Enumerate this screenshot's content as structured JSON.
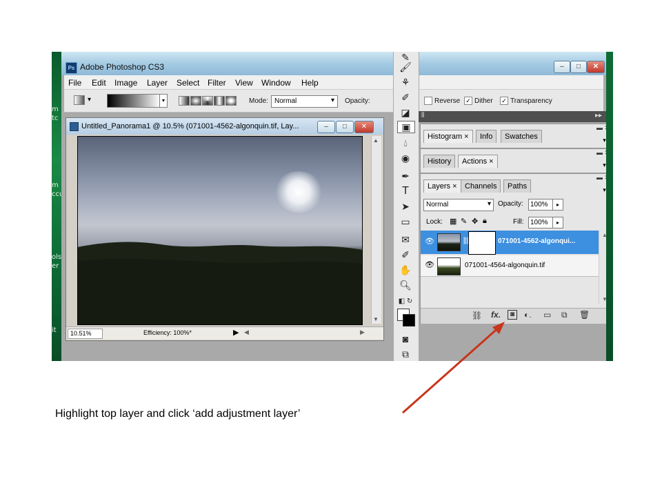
{
  "desktop": {
    "left_fragments": [
      "m",
      "tc",
      "m",
      "ccu",
      "ols",
      "er",
      "it"
    ]
  },
  "window": {
    "logo": "Ps",
    "title": "Adobe Photoshop CS3",
    "controls": {
      "minimize": "–",
      "maximize": "□",
      "close": "✕"
    }
  },
  "menu": [
    "File",
    "Edit",
    "Image",
    "Layer",
    "Select",
    "Filter",
    "View",
    "Window",
    "Help"
  ],
  "options_bar": {
    "mode_label": "Mode:",
    "mode_value": "Normal",
    "opacity_label": "Opacity:",
    "reverse_label": "Reverse",
    "reverse_checked": false,
    "dither_label": "Dither",
    "dither_checked": true,
    "transparency_label": "Transparency",
    "transparency_checked": true
  },
  "document": {
    "title": "Untitled_Panorama1 @ 10.5% (071001-4562-algonquin.tif, Lay...",
    "zoom": "10.51%",
    "status": "Efficiency: 100%*"
  },
  "palettes": {
    "group1_tabs": [
      "Histogram",
      "Info",
      "Swatches"
    ],
    "group2_tabs": [
      "History",
      "Actions"
    ],
    "layers_tabs": [
      "Layers",
      "Channels",
      "Paths"
    ],
    "blend_mode": "Normal",
    "opacity_label": "Opacity:",
    "opacity_value": "100%",
    "lock_label": "Lock:",
    "fill_label": "Fill:",
    "fill_value": "100%",
    "layers": [
      {
        "name": "071001-4562-algonqui...",
        "selected": true
      },
      {
        "name": "071001-4564-algonquin.tif",
        "selected": false
      }
    ]
  },
  "caption": "Highlight top layer and click ‘add adjustment layer’",
  "colors": {
    "accent_arrow": "#c8351c",
    "selection": "#3d8fe0"
  }
}
